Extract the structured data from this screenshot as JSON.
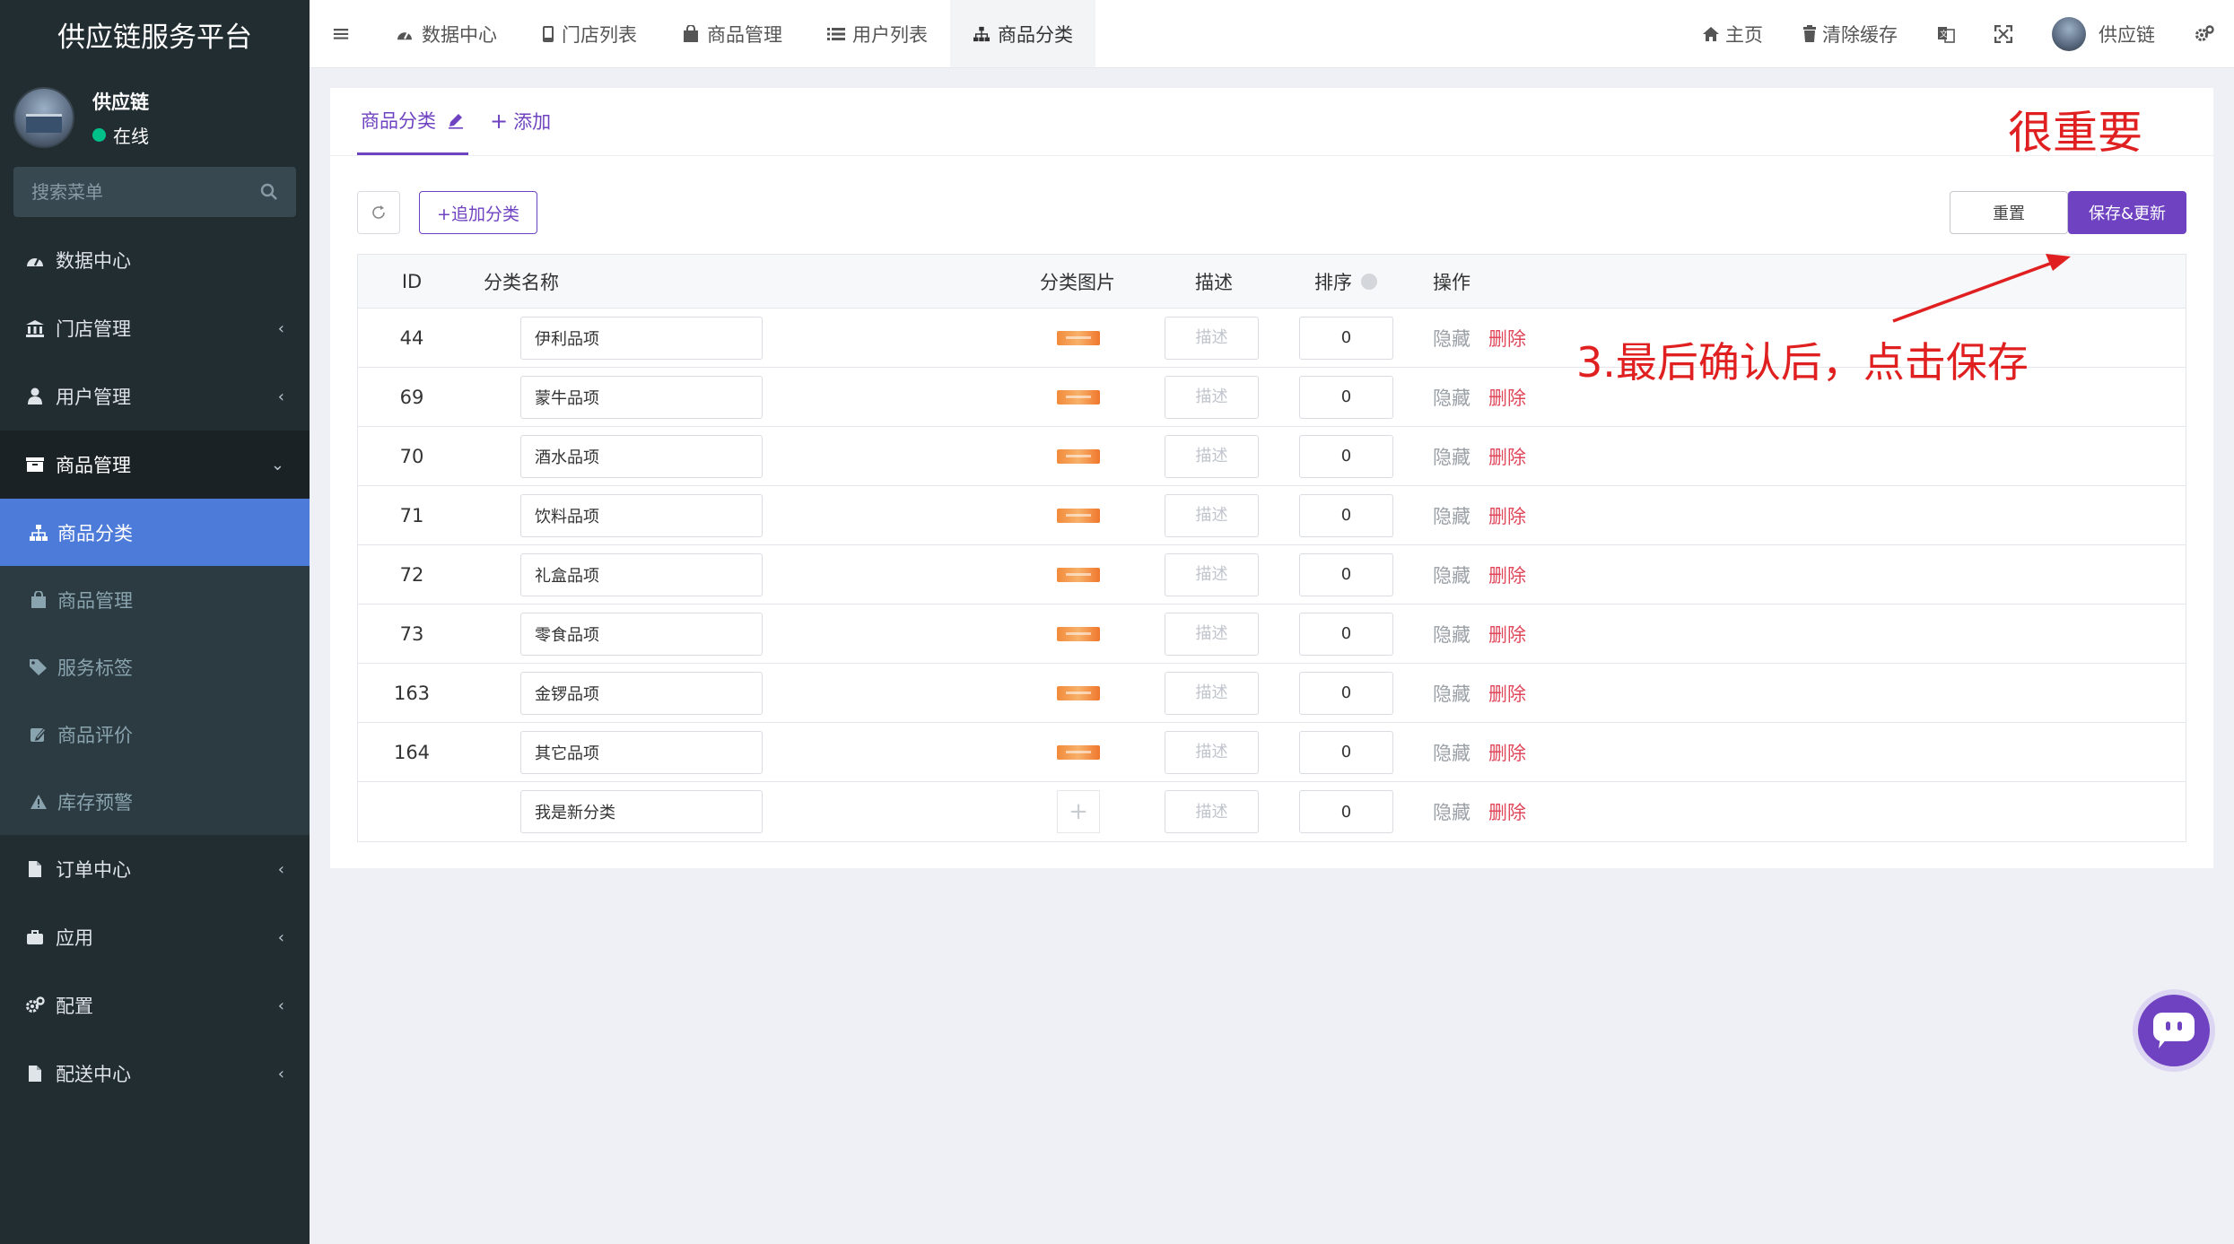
{
  "sidebar": {
    "brand": "供应链服务平台",
    "user": {
      "name": "供应链",
      "status": "在线"
    },
    "search_placeholder": "搜索菜单",
    "menu": [
      {
        "label": "数据中心",
        "icon": "dashboard-icon"
      },
      {
        "label": "门店管理",
        "icon": "bank-icon"
      },
      {
        "label": "用户管理",
        "icon": "user-icon"
      },
      {
        "label": "商品管理",
        "icon": "box-icon"
      }
    ],
    "submenu": [
      {
        "label": "商品分类",
        "icon": "sitemap-icon"
      },
      {
        "label": "商品管理",
        "icon": "shopping-bag-icon"
      },
      {
        "label": "服务标签",
        "icon": "tags-icon"
      },
      {
        "label": "商品评价",
        "icon": "edit-icon"
      },
      {
        "label": "库存预警",
        "icon": "warning-icon"
      }
    ],
    "menu_after": [
      {
        "label": "订单中心",
        "icon": "file-icon"
      },
      {
        "label": "应用",
        "icon": "briefcase-icon"
      },
      {
        "label": "配置",
        "icon": "cogs-icon"
      },
      {
        "label": "配送中心",
        "icon": "file-icon"
      }
    ]
  },
  "topnav": {
    "tabs": [
      {
        "label": "数据中心",
        "icon": "dashboard-icon"
      },
      {
        "label": "门店列表",
        "icon": "mobile-icon"
      },
      {
        "label": "商品管理",
        "icon": "shopping-bag-icon"
      },
      {
        "label": "用户列表",
        "icon": "list-icon"
      },
      {
        "label": "商品分类",
        "icon": "sitemap-icon"
      }
    ],
    "home": "主页",
    "clear_cache": "清除缓存",
    "user": "供应链"
  },
  "panel": {
    "tab_active": "商品分类",
    "tab_add": "添加",
    "add_category": "+追加分类",
    "reset": "重置",
    "save": "保存&更新",
    "columns": {
      "id": "ID",
      "name": "分类名称",
      "image": "分类图片",
      "desc": "描述",
      "sort": "排序",
      "actions": "操作"
    },
    "desc_placeholder": "描述",
    "hide_label": "隐藏",
    "delete_label": "删除",
    "rows": [
      {
        "id": "44",
        "name": "伊利品项",
        "sort": "0",
        "has_image": true
      },
      {
        "id": "69",
        "name": "蒙牛品项",
        "sort": "0",
        "has_image": true
      },
      {
        "id": "70",
        "name": "酒水品项",
        "sort": "0",
        "has_image": true
      },
      {
        "id": "71",
        "name": "饮料品项",
        "sort": "0",
        "has_image": true
      },
      {
        "id": "72",
        "name": "礼盒品项",
        "sort": "0",
        "has_image": true
      },
      {
        "id": "73",
        "name": "零食品项",
        "sort": "0",
        "has_image": true
      },
      {
        "id": "163",
        "name": "金锣品项",
        "sort": "0",
        "has_image": true
      },
      {
        "id": "164",
        "name": "其它品项",
        "sort": "0",
        "has_image": true
      },
      {
        "id": "",
        "name": "我是新分类",
        "sort": "0",
        "has_image": false
      }
    ]
  },
  "annotations": {
    "important": "很重要",
    "step": "3.最后确认后，点击保存",
    "color": "#e02020"
  },
  "colors": {
    "accent": "#6f42c1",
    "sidebar_bg": "#222d32",
    "active_menu": "#4c7bd9",
    "danger": "#e0475b"
  }
}
